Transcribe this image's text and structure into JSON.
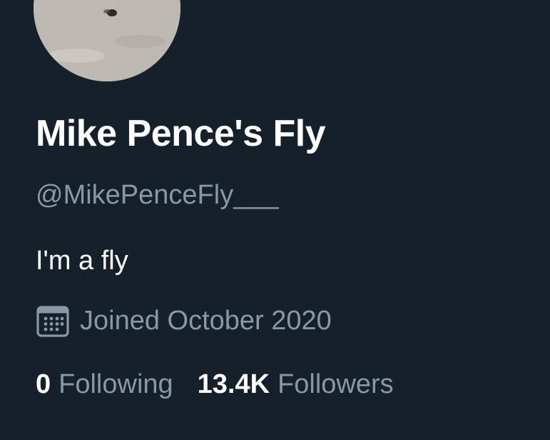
{
  "profile": {
    "display_name": "Mike Pence's Fly",
    "handle": "@MikePenceFly___",
    "bio": "I'm a fly",
    "joined": "Joined October 2020",
    "following_count": "0",
    "following_label": "Following",
    "followers_count": "13.4K",
    "followers_label": "Followers"
  },
  "icons": {
    "calendar": "calendar-icon"
  },
  "colors": {
    "background": "#15202b",
    "primary_text": "#ffffff",
    "secondary_text": "#8899a6"
  }
}
